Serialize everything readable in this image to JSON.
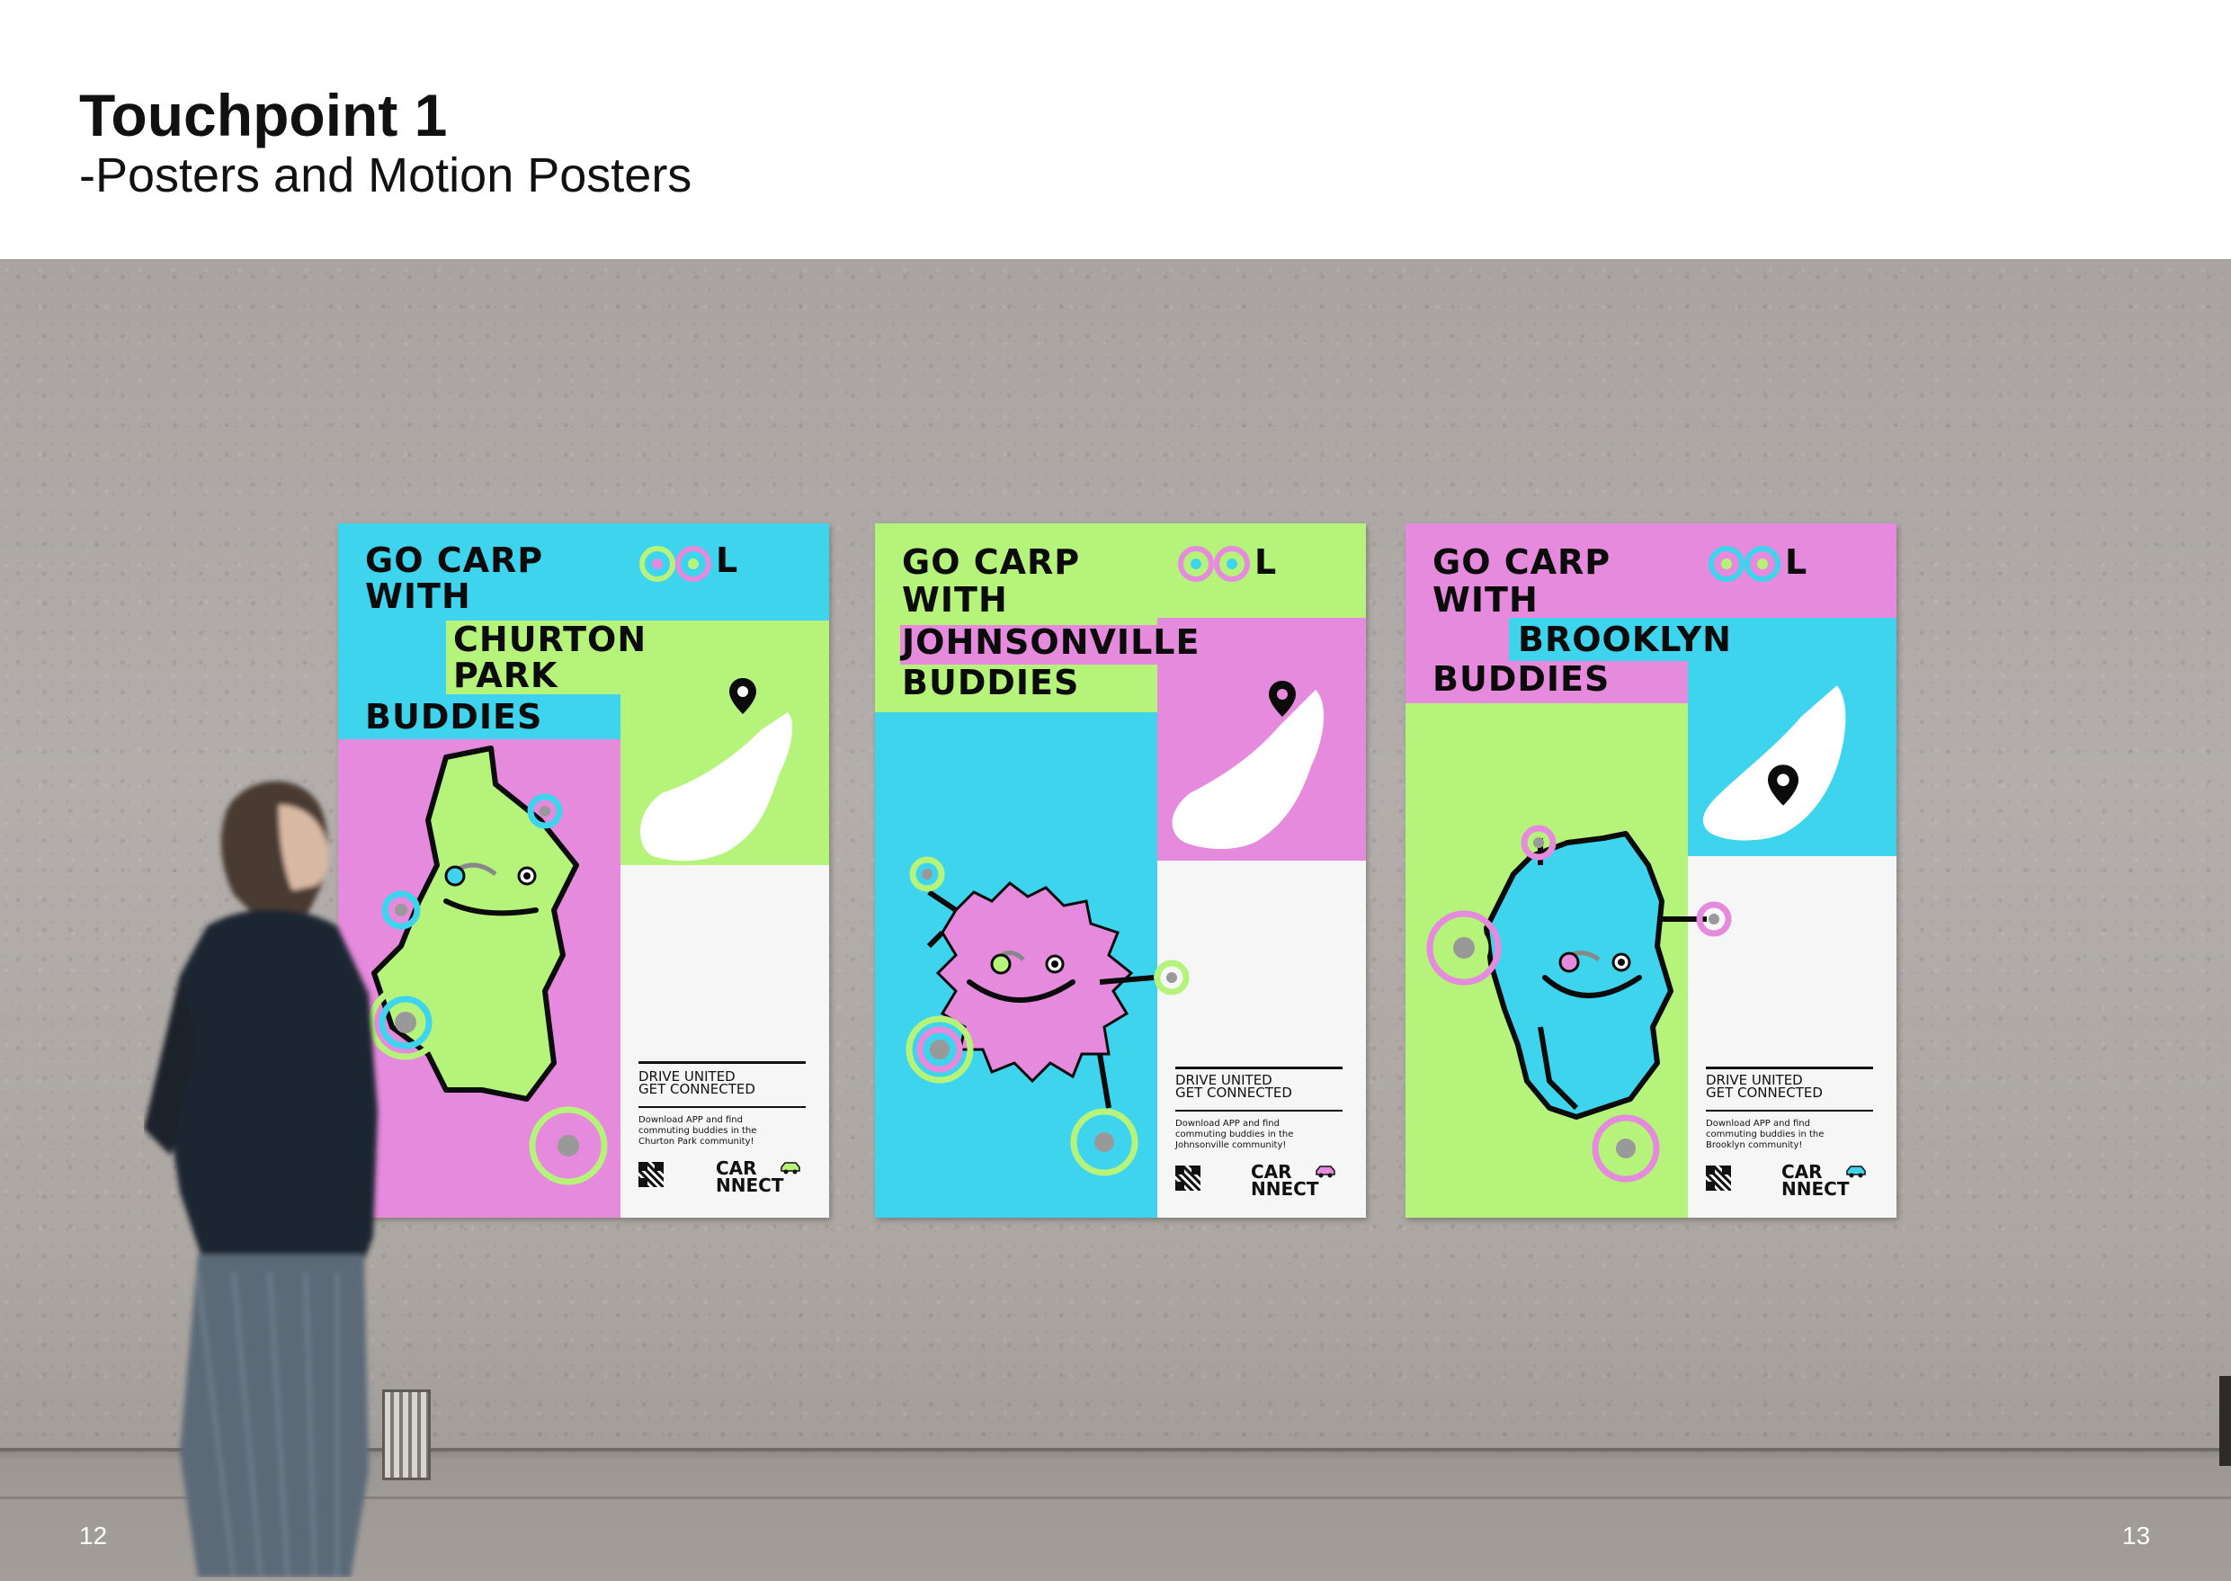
{
  "header": {
    "title": "Touchpoint 1",
    "subtitle": "-Posters and Motion Posters"
  },
  "page_numbers": {
    "left": "12",
    "right": "13"
  },
  "colors": {
    "cyan": "#3ed4ee",
    "magenta": "#e58adc",
    "lime": "#b6f37a",
    "white": "#f6f6f6",
    "ink": "#0b0b0b",
    "wall": "#aca7a3"
  },
  "posters": [
    {
      "headline_1": "GO CARP",
      "headline_2": "L",
      "headline_3": "WITH",
      "place_line_1": "CHURTON",
      "place_line_2": "PARK",
      "place_line_3": "BUDDIES",
      "tagline_1": "DRIVE UNITED",
      "tagline_2": "GET CONNECTED",
      "body": "Download APP and find commuting buddies in the Churton Park community!",
      "logo_1": "CAR",
      "logo_2": "NNECT",
      "character_color": "lime",
      "icons": [
        "location-pin-icon",
        "qr-code-icon",
        "car-icon"
      ]
    },
    {
      "headline_1": "GO CARP",
      "headline_2": "L",
      "headline_3": "WITH",
      "place_line_1": "JOHNSONVILLE",
      "place_line_2": "BUDDIES",
      "tagline_1": "DRIVE UNITED",
      "tagline_2": "GET CONNECTED",
      "body": "Download APP and find commuting buddies in the Johnsonville community!",
      "logo_1": "CAR",
      "logo_2": "NNECT",
      "character_color": "magenta",
      "icons": [
        "location-pin-icon",
        "qr-code-icon",
        "car-icon"
      ]
    },
    {
      "headline_1": "GO CARP",
      "headline_2": "L",
      "headline_3": "WITH",
      "place_line_1": "BROOKLYN",
      "place_line_2": "BUDDIES",
      "tagline_1": "DRIVE UNITED",
      "tagline_2": "GET CONNECTED",
      "body": "Download APP and find commuting buddies in the Brooklyn community!",
      "logo_1": "CAR",
      "logo_2": "NNECT",
      "character_color": "cyan",
      "icons": [
        "location-pin-icon",
        "qr-code-icon",
        "car-icon"
      ]
    }
  ]
}
